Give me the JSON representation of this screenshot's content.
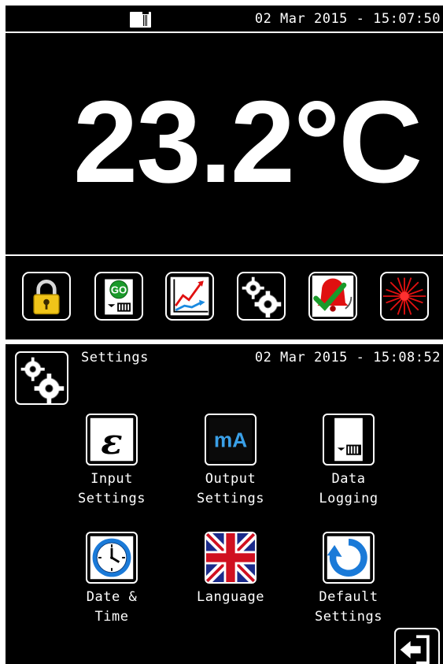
{
  "screen1": {
    "status": {
      "datetime": "02 Mar 2015 - 15:07:50",
      "sd_icon": "sd-card-icon"
    },
    "reading": "23.2°C",
    "toolbar": [
      {
        "name": "lock-button",
        "icon": "padlock-icon"
      },
      {
        "name": "logging-go-button",
        "icon": "sd-go-icon",
        "label": "GO"
      },
      {
        "name": "trend-button",
        "icon": "trend-chart-icon"
      },
      {
        "name": "settings-button",
        "icon": "gears-icon"
      },
      {
        "name": "alarm-button",
        "icon": "alarm-check-icon"
      },
      {
        "name": "laser-button",
        "icon": "laser-icon"
      }
    ]
  },
  "screen2": {
    "title": "Settings",
    "datetime": "02 Mar 2015 - 15:08:52",
    "tiles": [
      {
        "line1": "Input",
        "line2": "Settings",
        "icon": "epsilon-icon",
        "glyph": "ε"
      },
      {
        "line1": "Output",
        "line2": "Settings",
        "icon": "milliamp-icon",
        "glyph": "mA"
      },
      {
        "line1": "Data",
        "line2": "Logging",
        "icon": "sd-card-icon"
      },
      {
        "line1": "Date &",
        "line2": "Time",
        "icon": "clock-icon"
      },
      {
        "line1": "Language",
        "line2": "",
        "icon": "uk-flag-icon"
      },
      {
        "line1": "Default",
        "line2": "Settings",
        "icon": "reset-icon"
      }
    ],
    "exit_icon": "exit-icon"
  },
  "colors": {
    "background": "#000000",
    "foreground": "#ffffff",
    "go_green": "#1a9a2a",
    "lock_gold": "#f0c419",
    "laser_red": "#e01010",
    "ma_blue": "#3aa0e8"
  }
}
